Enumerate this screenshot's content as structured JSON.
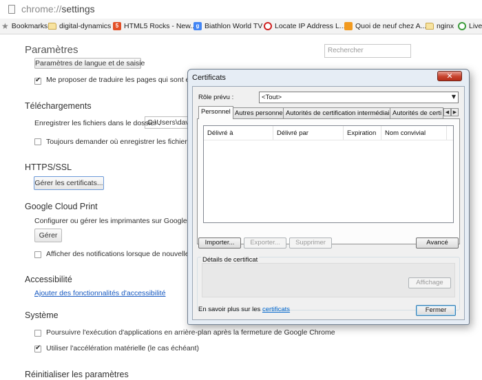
{
  "browser": {
    "url_scheme": "chrome://",
    "url_path": "settings",
    "bookmarks": [
      {
        "label": "Bookmarks",
        "icon": "star-icon"
      },
      {
        "label": "digital-dynamics",
        "icon": "folder-icon"
      },
      {
        "label": "HTML5 Rocks - New...",
        "icon": "html5-icon"
      },
      {
        "label": "Biathlon World TV",
        "icon": "google-icon"
      },
      {
        "label": "Locate IP Address L...",
        "icon": "target-icon"
      },
      {
        "label": "Quoi de neuf chez A...",
        "icon": "site-icon"
      },
      {
        "label": "nginx",
        "icon": "folder-icon"
      },
      {
        "label": "Live",
        "icon": "live-icon"
      }
    ]
  },
  "settings": {
    "title": "Paramètres",
    "search_placeholder": "Rechercher",
    "lang_button": "Paramètres de langue et de saisie",
    "translate_label": "Me proposer de traduire les pages qui sont écrite",
    "downloads": {
      "heading": "Téléchargements",
      "save_label": "Enregistrer les fichiers dans le dossier :",
      "path_value": "C:\\Users\\davi",
      "ask_label": "Toujours demander où enregistrer les fichiers"
    },
    "https": {
      "heading": "HTTPS/SSL",
      "manage_button": "Gérer les certificats..."
    },
    "cloud_print": {
      "heading": "Google Cloud Print",
      "desc": "Configurer ou gérer les imprimantes sur Google Cloud",
      "manage_button": "Gérer",
      "notify_label": "Afficher des notifications lorsque de nouvelles imp"
    },
    "accessibility": {
      "heading": "Accessibilité",
      "link": "Ajouter des fonctionnalités d'accessibilité"
    },
    "system": {
      "heading": "Système",
      "background_label": "Poursuivre l'exécution d'applications en arrière-plan après la fermeture de Google Chrome",
      "hw_accel_label": "Utiliser l'accélération matérielle (le cas échéant)"
    },
    "reset_heading": "Réinitialiser les paramètres"
  },
  "dialog": {
    "title": "Certificats",
    "role_label": "Rôle prévu :",
    "role_value": "<Tout>",
    "tabs": [
      "Personnel",
      "Autres personnes",
      "Autorités de certification intermédiaires",
      "Autorités de certi"
    ],
    "columns": [
      "Délivré à",
      "Délivré par",
      "Expiration",
      "Nom convivial"
    ],
    "buttons": {
      "import": "Importer...",
      "export": "Exporter...",
      "delete": "Supprimer",
      "advanced": "Avancé",
      "view": "Affichage",
      "close": "Fermer"
    },
    "details_label": "Détails de certificat",
    "learn_more_prefix": "En savoir plus sur les",
    "learn_more_link": "certificats"
  }
}
